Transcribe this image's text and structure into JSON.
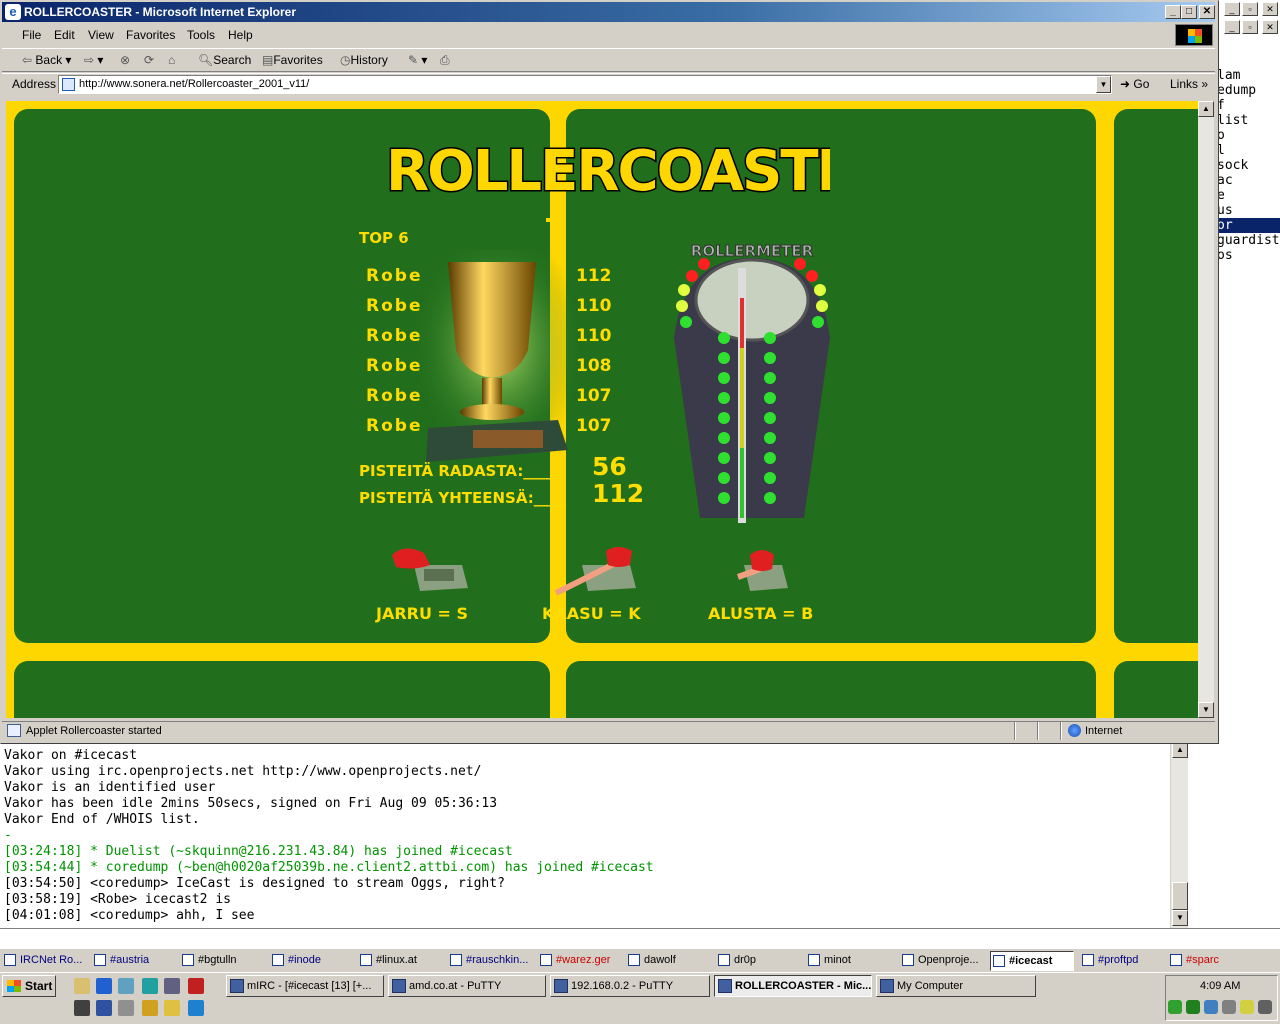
{
  "mirc": {
    "nicklist": [
      "lam",
      "edump",
      "f",
      "list",
      "o",
      "l",
      "sock",
      "ac",
      "e",
      "us",
      "or",
      "guardist",
      "os"
    ],
    "nicklist_selected_index": 10,
    "chat_lines": [
      {
        "text": "Vakor on #icecast",
        "color": "default"
      },
      {
        "text": "Vakor using irc.openprojects.net http://www.openprojects.net/",
        "color": "default"
      },
      {
        "text": "Vakor is an identified user",
        "color": "default"
      },
      {
        "text": "Vakor has been idle 2mins 50secs, signed on Fri Aug 09 05:36:13",
        "color": "default"
      },
      {
        "text": "Vakor End of /WHOIS list.",
        "color": "default"
      },
      {
        "text": "-",
        "color": "green"
      },
      {
        "text": "[03:24:18] * Duelist (~skquinn@216.231.43.84) has joined #icecast",
        "color": "green"
      },
      {
        "text": "[03:54:44] * coredump (~ben@h0020af25039b.ne.client2.attbi.com) has joined #icecast",
        "color": "green"
      },
      {
        "text": "[03:54:50] <coredump> IceCast is designed to stream Oggs, right?",
        "color": "default"
      },
      {
        "text": "[03:58:19] <Robe> icecast2 is",
        "color": "default"
      },
      {
        "text": "[04:01:08] <coredump> ahh, I see",
        "color": "default"
      }
    ]
  },
  "ie": {
    "title": "ROLLERCOASTER - Microsoft Internet Explorer",
    "menu": [
      "File",
      "Edit",
      "View",
      "Favorites",
      "Tools",
      "Help"
    ],
    "toolbar": {
      "back": "Back",
      "search": "Search",
      "favorites": "Favorites",
      "history": "History"
    },
    "address_label": "Address",
    "address_value": "http://www.sonera.net/Rollercoaster_2001_v11/",
    "go_label": "Go",
    "links_label": "Links",
    "status_text": "Applet Rollercoaster started",
    "status_zone": "Internet"
  },
  "game": {
    "logo": "ROLLERCOASTER",
    "top_title": "TOP 6",
    "scores": [
      {
        "name": "Robe",
        "score": "112"
      },
      {
        "name": "Robe",
        "score": "110"
      },
      {
        "name": "Robe",
        "score": "110"
      },
      {
        "name": "Robe",
        "score": "108"
      },
      {
        "name": "Robe",
        "score": "107"
      },
      {
        "name": "Robe",
        "score": "107"
      }
    ],
    "points_track_label": "PISTEITÄ RADASTA:____",
    "points_track_value": "56",
    "points_total_label": "PISTEITÄ YHTEENSÄ:____",
    "points_total_value": "112",
    "meter_label": "ROLLERMETER",
    "controls": [
      "JARRU = S",
      "KAASU = K",
      "ALUSTA = B"
    ]
  },
  "taskbar": {
    "window_tabs": [
      {
        "label": "IRCNet Ro...",
        "color": "#000080"
      },
      {
        "label": "#austria",
        "color": "#000080"
      },
      {
        "label": "#bgtulln",
        "color": "#000000"
      },
      {
        "label": "#inode",
        "color": "#000080"
      },
      {
        "label": "#linux.at",
        "color": "#000000"
      },
      {
        "label": "#rauschkin...",
        "color": "#000080"
      },
      {
        "label": "#warez.ger",
        "color": "#cc0000"
      },
      {
        "label": "dawolf",
        "color": "#000000"
      },
      {
        "label": "dr0p",
        "color": "#000000"
      },
      {
        "label": "minot",
        "color": "#000000"
      },
      {
        "label": "Openproje...",
        "color": "#000000"
      },
      {
        "label": "#icecast",
        "color": "#000000"
      },
      {
        "label": "#proftpd",
        "color": "#000080"
      },
      {
        "label": "#sparc",
        "color": "#cc0000"
      }
    ],
    "active_tab_index": 11,
    "start_label": "Start",
    "tasks": [
      {
        "label": "mIRC - [#icecast [13] [+..."
      },
      {
        "label": "amd.co.at - PuTTY"
      },
      {
        "label": "192.168.0.2 - PuTTY"
      },
      {
        "label": "ROLLERCOASTER - Mic..."
      },
      {
        "label": "My Computer"
      }
    ],
    "active_task_index": 3,
    "clock": "4:09 AM"
  }
}
